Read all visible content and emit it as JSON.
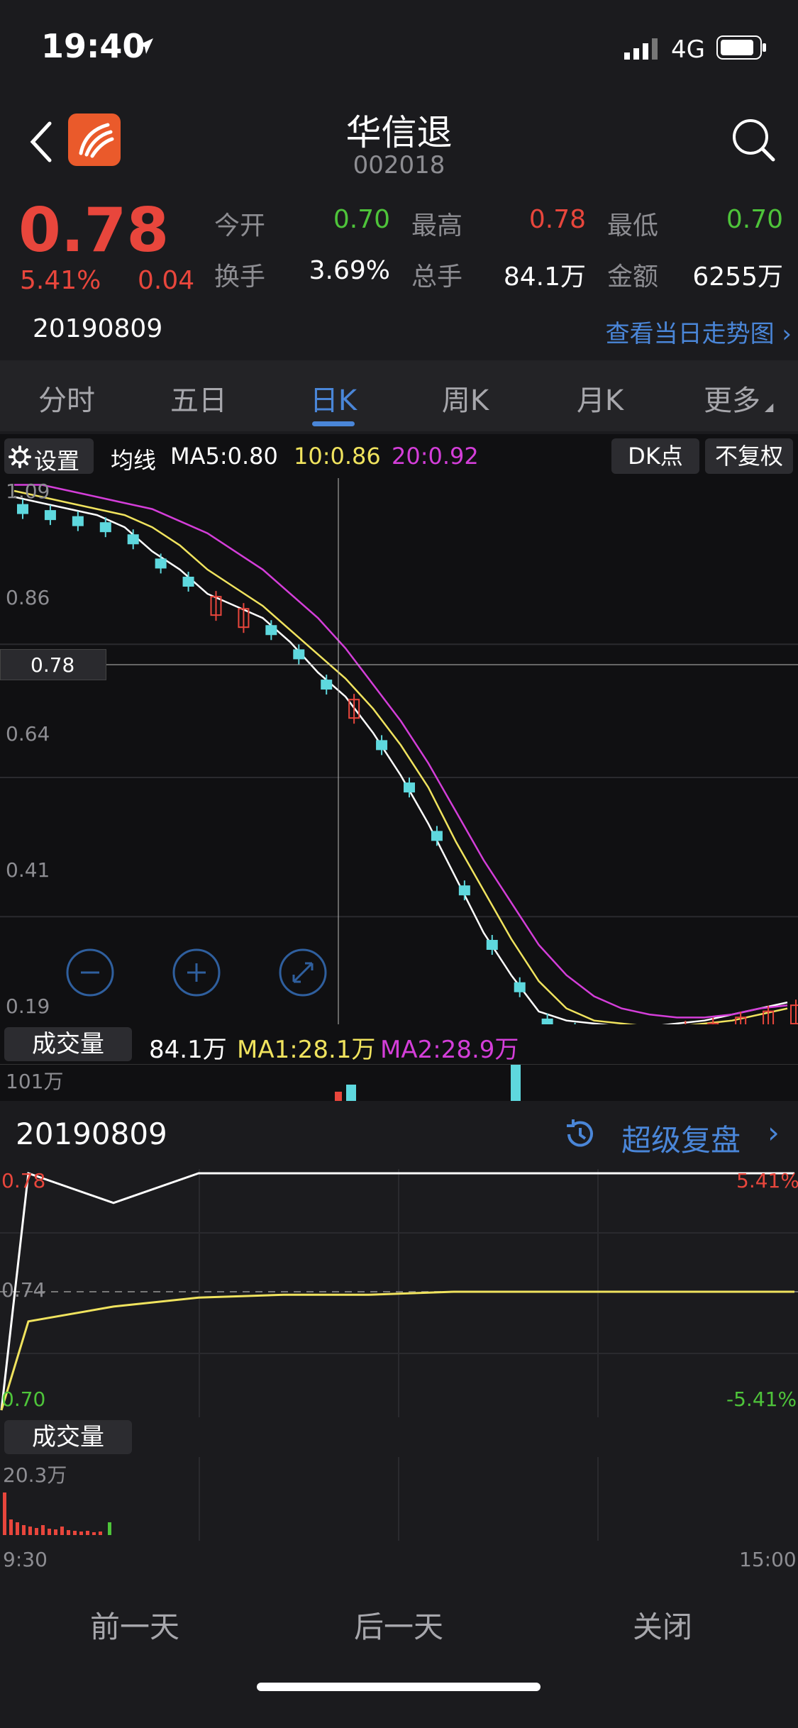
{
  "status": {
    "time": "19:40",
    "network": "4G"
  },
  "header": {
    "title": "华信退",
    "code": "002018"
  },
  "quote": {
    "price": "0.78",
    "change_pct": "5.41%",
    "change": "0.04",
    "date": "20190809",
    "open_label": "今开",
    "open": "0.70",
    "high_label": "最高",
    "high": "0.78",
    "low_label": "最低",
    "low": "0.70",
    "turnover_label": "换手",
    "turnover": "3.69%",
    "volume_label": "总手",
    "volume": "84.1万",
    "amount_label": "金额",
    "amount": "6255万",
    "trend_link": "查看当日走势图"
  },
  "tabs": [
    {
      "label": "分时"
    },
    {
      "label": "五日"
    },
    {
      "label": "日K"
    },
    {
      "label": "周K"
    },
    {
      "label": "月K"
    },
    {
      "label": "更多"
    }
  ],
  "kline": {
    "settings_label": "设置",
    "ma_label": "均线",
    "ma5": "MA5:0.80",
    "ma10": "10:0.86",
    "ma20": "20:0.92",
    "dk_label": "DK点",
    "adjust_label": "不复权",
    "y_labels": [
      "1.09",
      "0.86",
      "0.64",
      "0.41",
      "0.19"
    ],
    "crosshair_price": "0.78",
    "volume_label": "成交量",
    "volume_value": "84.1万",
    "vol_ma1": "MA1:28.1万",
    "vol_ma2": "MA2:28.9万",
    "vol_max": "101万"
  },
  "review": {
    "date": "20190809",
    "title": "超级复盘",
    "price_top": "0.78",
    "price_mid": "0.74",
    "price_bottom": "0.70",
    "pct_top": "5.41%",
    "pct_bottom": "-5.41%",
    "volume_label": "成交量",
    "volume_max": "20.3万",
    "time_start": "9:30",
    "time_end": "15:00",
    "prev_label": "前一天",
    "next_label": "后一天",
    "close_label": "关闭"
  },
  "colors": {
    "up": "#e8463c",
    "down": "#5ed8de",
    "ma5": "#ffffff",
    "ma10": "#f0e35e",
    "ma20": "#d43ed9",
    "link": "#4a86d8",
    "background": "#1b1b1e"
  },
  "chart_data": [
    {
      "type": "line",
      "title": "日K",
      "series": [
        {
          "name": "MA5",
          "values": [
            1.08,
            1.07,
            1.06,
            1.05,
            1.03,
            0.99,
            0.96,
            0.92,
            0.9,
            0.88,
            0.84,
            0.79,
            0.75,
            0.69,
            0.62,
            0.54,
            0.45,
            0.36,
            0.29,
            0.23,
            0.215,
            0.21,
            0.205,
            0.205,
            0.21,
            0.215,
            0.225,
            0.235,
            0.245
          ]
        },
        {
          "name": "10",
          "values": [
            1.09,
            1.08,
            1.07,
            1.06,
            1.05,
            1.03,
            1.0,
            0.96,
            0.93,
            0.9,
            0.86,
            0.82,
            0.78,
            0.73,
            0.67,
            0.6,
            0.51,
            0.43,
            0.35,
            0.28,
            0.235,
            0.215,
            0.21,
            0.205,
            0.205,
            0.21,
            0.215,
            0.225,
            0.235
          ]
        },
        {
          "name": "20",
          "values": [
            1.1,
            1.1,
            1.09,
            1.08,
            1.07,
            1.06,
            1.04,
            1.02,
            0.99,
            0.96,
            0.92,
            0.88,
            0.83,
            0.77,
            0.71,
            0.64,
            0.56,
            0.48,
            0.41,
            0.34,
            0.29,
            0.255,
            0.235,
            0.225,
            0.22,
            0.22,
            0.225,
            0.235,
            0.24
          ]
        }
      ],
      "ylim": [
        0.19,
        1.09
      ]
    },
    {
      "type": "line",
      "title": "超级复盘",
      "series": [
        {
          "name": "price",
          "values": [
            0.7,
            0.78,
            0.77,
            0.78,
            0.78,
            0.78,
            0.78,
            0.78,
            0.78,
            0.78,
            0.78
          ]
        },
        {
          "name": "avg",
          "values": [
            0.7,
            0.73,
            0.735,
            0.738,
            0.739,
            0.739,
            0.74,
            0.74,
            0.74,
            0.74,
            0.74
          ]
        }
      ],
      "ylim": [
        0.7,
        0.78
      ]
    }
  ]
}
